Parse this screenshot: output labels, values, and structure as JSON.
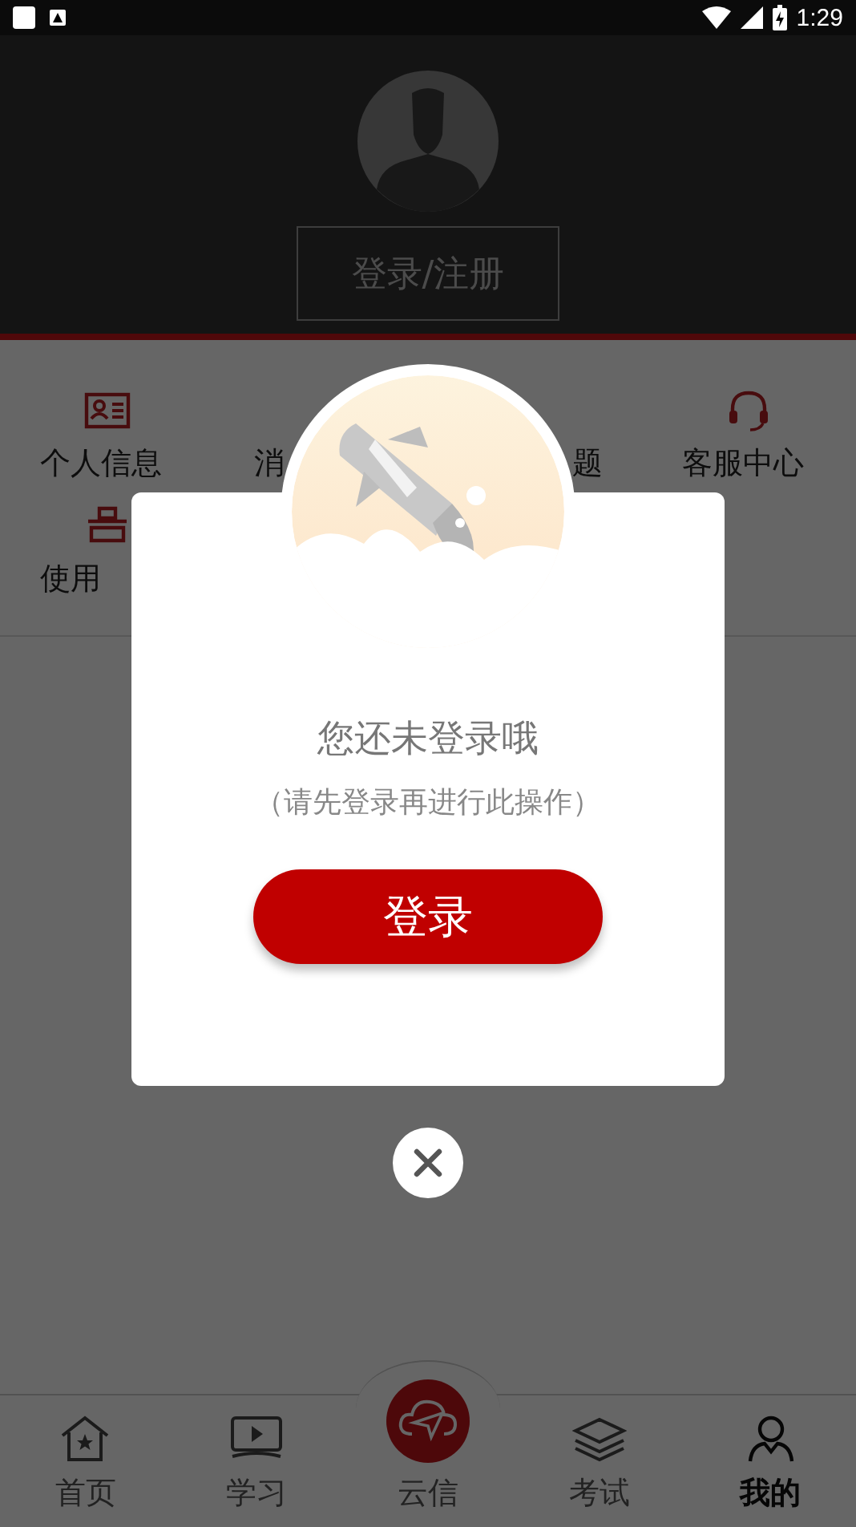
{
  "status_bar": {
    "time": "1:29"
  },
  "profile": {
    "login_button": "登录/注册"
  },
  "menu_items": [
    {
      "label": "个人信息"
    },
    {
      "label": "消"
    },
    {
      "label": "题"
    },
    {
      "label": "客服中心"
    },
    {
      "label": "使用"
    }
  ],
  "bottom_nav": [
    {
      "label": "首页",
      "selected": false
    },
    {
      "label": "学习",
      "selected": false
    },
    {
      "label": "云信",
      "selected": false
    },
    {
      "label": "考试",
      "selected": false
    },
    {
      "label": "我的",
      "selected": true
    }
  ],
  "dialog": {
    "title": "您还未登录哦",
    "subtitle": "（请先登录再进行此操作）",
    "button": "登录"
  }
}
